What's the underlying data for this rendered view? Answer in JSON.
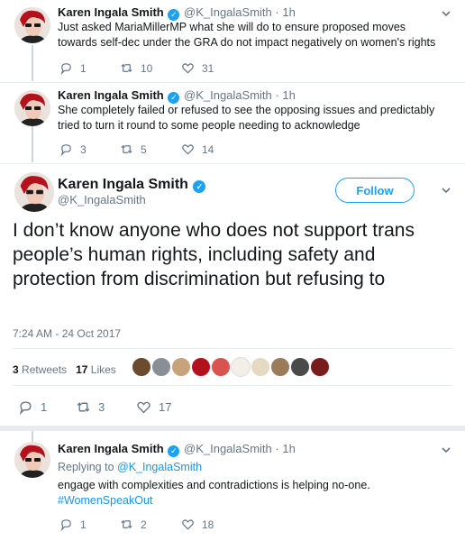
{
  "tweets_above": [
    {
      "name": "Karen Ingala Smith",
      "handle": "@K_IngalaSmith",
      "dot": "·",
      "time": "1h",
      "text": "Just asked MariaMillerMP what she will do to ensure proposed moves towards self-dec under the GRA do not impact negatively on women's rights",
      "replies": "1",
      "retweets": "10",
      "likes": "31"
    },
    {
      "name": "Karen Ingala Smith",
      "handle": "@K_IngalaSmith",
      "dot": "·",
      "time": "1h",
      "text": "She completely failed or refused to see the opposing issues and predictably tried to turn it round to some people needing to acknowledge",
      "replies": "3",
      "retweets": "5",
      "likes": "14"
    }
  ],
  "main_tweet": {
    "name": "Karen Ingala Smith",
    "handle": "@K_IngalaSmith",
    "follow_label": "Follow",
    "text": "I don’t know anyone who does not support trans people’s human rights, including safety and protection from discrimination but refusing to",
    "timestamp": "7:24 AM - 24 Oct 2017",
    "retweet_count": "3",
    "retweet_label": "Retweets",
    "like_count": "17",
    "like_label": "Likes",
    "replies": "1",
    "retweets": "3",
    "likes": "17"
  },
  "reply_tweet": {
    "name": "Karen Ingala Smith",
    "handle": "@K_IngalaSmith",
    "dot": "·",
    "time": "1h",
    "replying_prefix": "Replying to",
    "replying_handle": "@K_IngalaSmith",
    "text": "engage with complexities and contradictions is helping no-one.",
    "hashtag": "#WomenSpeakOut",
    "replies": "1",
    "retweets": "2",
    "likes": "18"
  },
  "colors": {
    "accent": "#1da1f2",
    "muted": "#657786",
    "text": "#14171a"
  },
  "icons": [
    "reply-icon",
    "retweet-icon",
    "like-icon",
    "verified-icon",
    "chevron-down-icon"
  ]
}
